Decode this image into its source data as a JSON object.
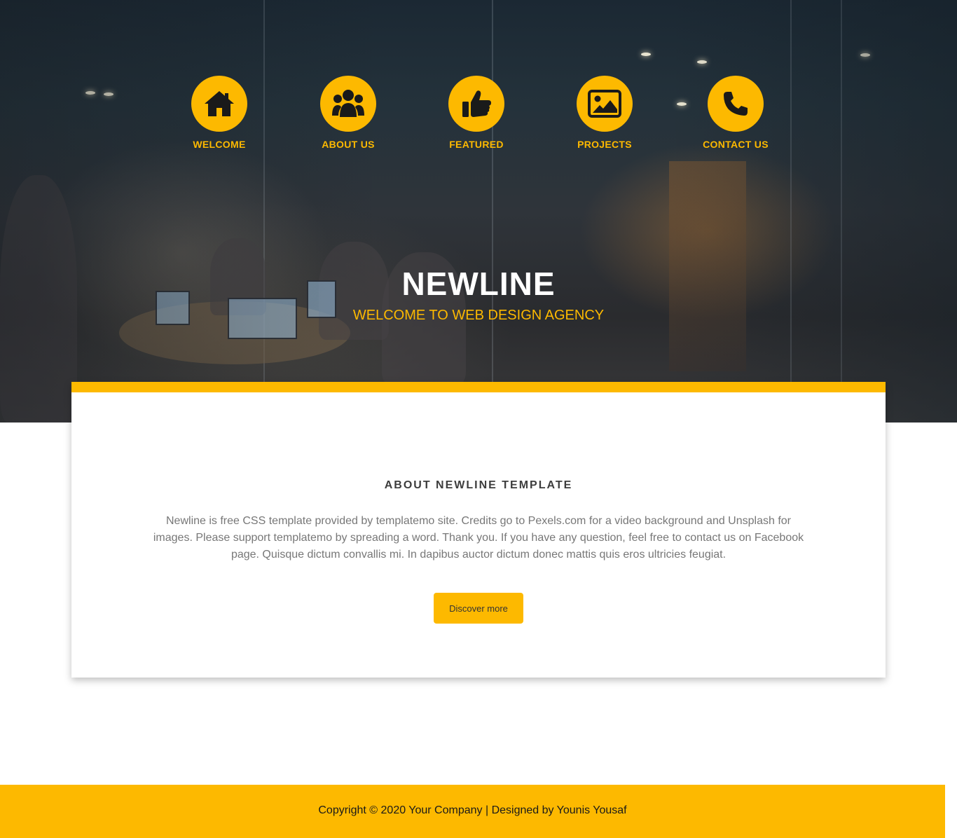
{
  "nav": {
    "items": [
      {
        "label": "WELCOME",
        "icon": "home-icon"
      },
      {
        "label": "ABOUT US",
        "icon": "users-icon"
      },
      {
        "label": "FEATURED",
        "icon": "thumbs-up-icon"
      },
      {
        "label": "PROJECTS",
        "icon": "image-icon"
      },
      {
        "label": "CONTACT US",
        "icon": "phone-icon"
      }
    ]
  },
  "hero": {
    "title": "NEWLINE",
    "subtitle": "WELCOME TO WEB DESIGN AGENCY"
  },
  "about": {
    "title": "ABOUT NEWLINE TEMPLATE",
    "text": "Newline is free CSS template provided by templatemo site. Credits go to Pexels.com for a video background and Unsplash for images. Please support templatemo by spreading a word. Thank you. If you have any question, feel free to contact us on Facebook page. Quisque dictum convallis mi. In dapibus auctor dictum donec mattis quis eros ultricies feugiat.",
    "button_label": "Discover more"
  },
  "footer": {
    "copyright": "Copyright © 2020 Your Company | Designed by Younis Yousaf"
  },
  "colors": {
    "accent": "#fdb900",
    "icon": "#1a1a1a",
    "hero_title": "#ffffff"
  }
}
